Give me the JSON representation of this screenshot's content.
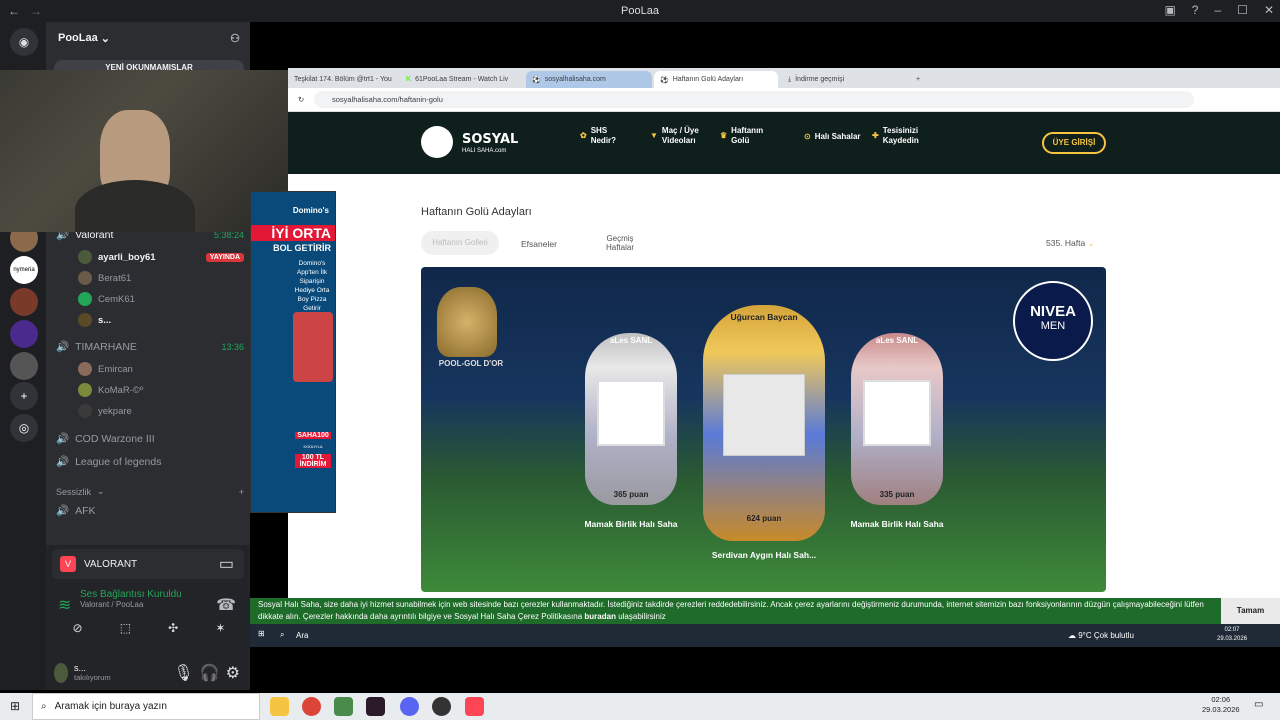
{
  "window": {
    "title": "PooLaa",
    "title_icon": "discord-icon"
  },
  "discord": {
    "guild_name": "PooLaa",
    "unread_label": "YENİ OKUNMAMIŞLAR",
    "channels": [
      {
        "name": "Valorant",
        "time": "5:38:24",
        "users": [
          {
            "name": "ayarli_boy61",
            "badge": "YAYINDA"
          },
          {
            "name": "Berat61"
          },
          {
            "name": "CemK61"
          },
          {
            "name": "s..."
          }
        ]
      },
      {
        "name": "TIMARHANE",
        "time": "13:36",
        "users": [
          {
            "name": "Emircan"
          },
          {
            "name": "KoMaR-©º"
          },
          {
            "name": "yekpare"
          }
        ]
      },
      {
        "name": "COD Warzone III"
      },
      {
        "name": "League of legends"
      }
    ],
    "category_silent": "Sessizlik",
    "afk_channel": "AFK",
    "activity": {
      "game": "VALORANT"
    },
    "voice": {
      "status": "Ses Bağlantısı Kuruldu",
      "location": "Valorant / PooLaa"
    },
    "user": {
      "name": "s...",
      "status": "takılıyorum"
    }
  },
  "browser": {
    "tabs": [
      "Teşkilat 174. Bölüm @trt1 - You",
      "61PooLaa Stream - Watch Liv",
      "sosyalhalisaha.com",
      "Haftanın Golü Adayları",
      "İndirme geçmişi"
    ],
    "url": "sosyalhalisaha.com/haftanin-golu"
  },
  "site": {
    "logo_main": "SOSYAL",
    "logo_sub": "HALI SAHA.com",
    "nav": [
      "SHS Nedir?",
      "Maç / Üye Videoları",
      "Haftanın Golü",
      "Halı Sahalar",
      "Tesisinizi Kaydedin"
    ],
    "login": "ÜYE GİRİŞİ",
    "section_title": "Haftanın Golü Adayları",
    "subtabs": [
      "Haftanın Golleri",
      "Efsaneler",
      "Geçmiş Haftalar"
    ],
    "week": "535. Hafta",
    "trophy_label": "POOL-GOL D'OR",
    "sponsor": [
      "NIVEA",
      "MEN"
    ],
    "candidates": [
      {
        "player": "aLes SANL",
        "points": "365 puan",
        "venue": "Mamak Birlik Halı Saha"
      },
      {
        "player": "Uğurcan Baycan",
        "points": "624 puan",
        "venue": "Serdivan Aygın Halı Sah..."
      },
      {
        "player": "aLes SANL",
        "points": "335 puan",
        "venue": "Mamak Birlik Halı Saha"
      }
    ],
    "ad": {
      "brand": "Domino's",
      "headline": "İYİ ORTA",
      "headline2": "BOL GETİRİR",
      "body": "Domino's App'ten İlk Siparişin Hediye Orta Boy Pizza Getirir",
      "code": "SAHA100",
      "code_sub": "KODUYLA",
      "discount": "100 TL İNDİRİM"
    },
    "cookie_text": "Sosyal Halı Saha, size daha iyi hizmet sunabilmek için web sitesinde bazı çerezler kullanmaktadır. İstediğiniz takdirde çerezleri reddedebilirsiniz. Ancak çerez ayarlarını değiştirmeniz durumunda, internet sitemizin bazı fonksiyonlarının düzgün çalışmayabileceğini lütfen dikkate alın. Çerezler hakkında daha ayrıntılı bilgiye ve Sosyal Halı Saha Çerez Politikasına",
    "cookie_link": "buradan",
    "cookie_tail": "ulaşabilirsiniz",
    "cookie_ok": "Tamam"
  },
  "inner_taskbar": {
    "search": "Ara",
    "weather": "9°C  Çok bulutlu",
    "time": "02:07",
    "date": "29.03.2026"
  },
  "taskbar": {
    "search_placeholder": "Aramak için buraya yazın",
    "time": "02:06",
    "date": "29.03.2026"
  }
}
